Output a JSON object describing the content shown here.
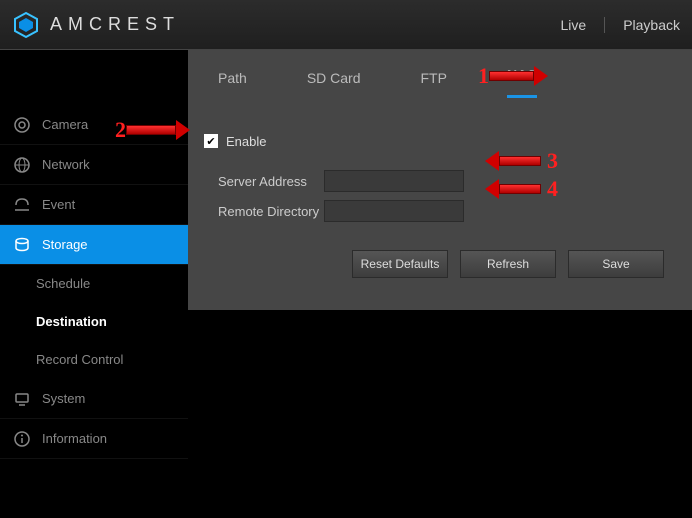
{
  "brand": "AMCREST",
  "header": {
    "live": "Live",
    "playback": "Playback"
  },
  "sidebar": {
    "items": [
      {
        "label": "Camera",
        "icon": "camera-icon"
      },
      {
        "label": "Network",
        "icon": "network-icon"
      },
      {
        "label": "Event",
        "icon": "event-icon"
      },
      {
        "label": "Storage",
        "icon": "storage-icon",
        "active": true
      },
      {
        "label": "System",
        "icon": "system-icon"
      },
      {
        "label": "Information",
        "icon": "info-icon"
      }
    ],
    "storage_sub": [
      {
        "label": "Schedule"
      },
      {
        "label": "Destination",
        "current": true
      },
      {
        "label": "Record Control"
      }
    ]
  },
  "tabs": [
    {
      "label": "Path"
    },
    {
      "label": "SD Card"
    },
    {
      "label": "FTP"
    },
    {
      "label": "NAS",
      "active": true
    }
  ],
  "form": {
    "enable_label": "Enable",
    "enable_checked": true,
    "server_address_label": "Server Address",
    "server_address_value": "",
    "remote_directory_label": "Remote Directory",
    "remote_directory_value": ""
  },
  "buttons": {
    "reset": "Reset Defaults",
    "refresh": "Refresh",
    "save": "Save"
  },
  "annotations": {
    "a1": "1",
    "a2": "2",
    "a3": "3",
    "a4": "4"
  }
}
